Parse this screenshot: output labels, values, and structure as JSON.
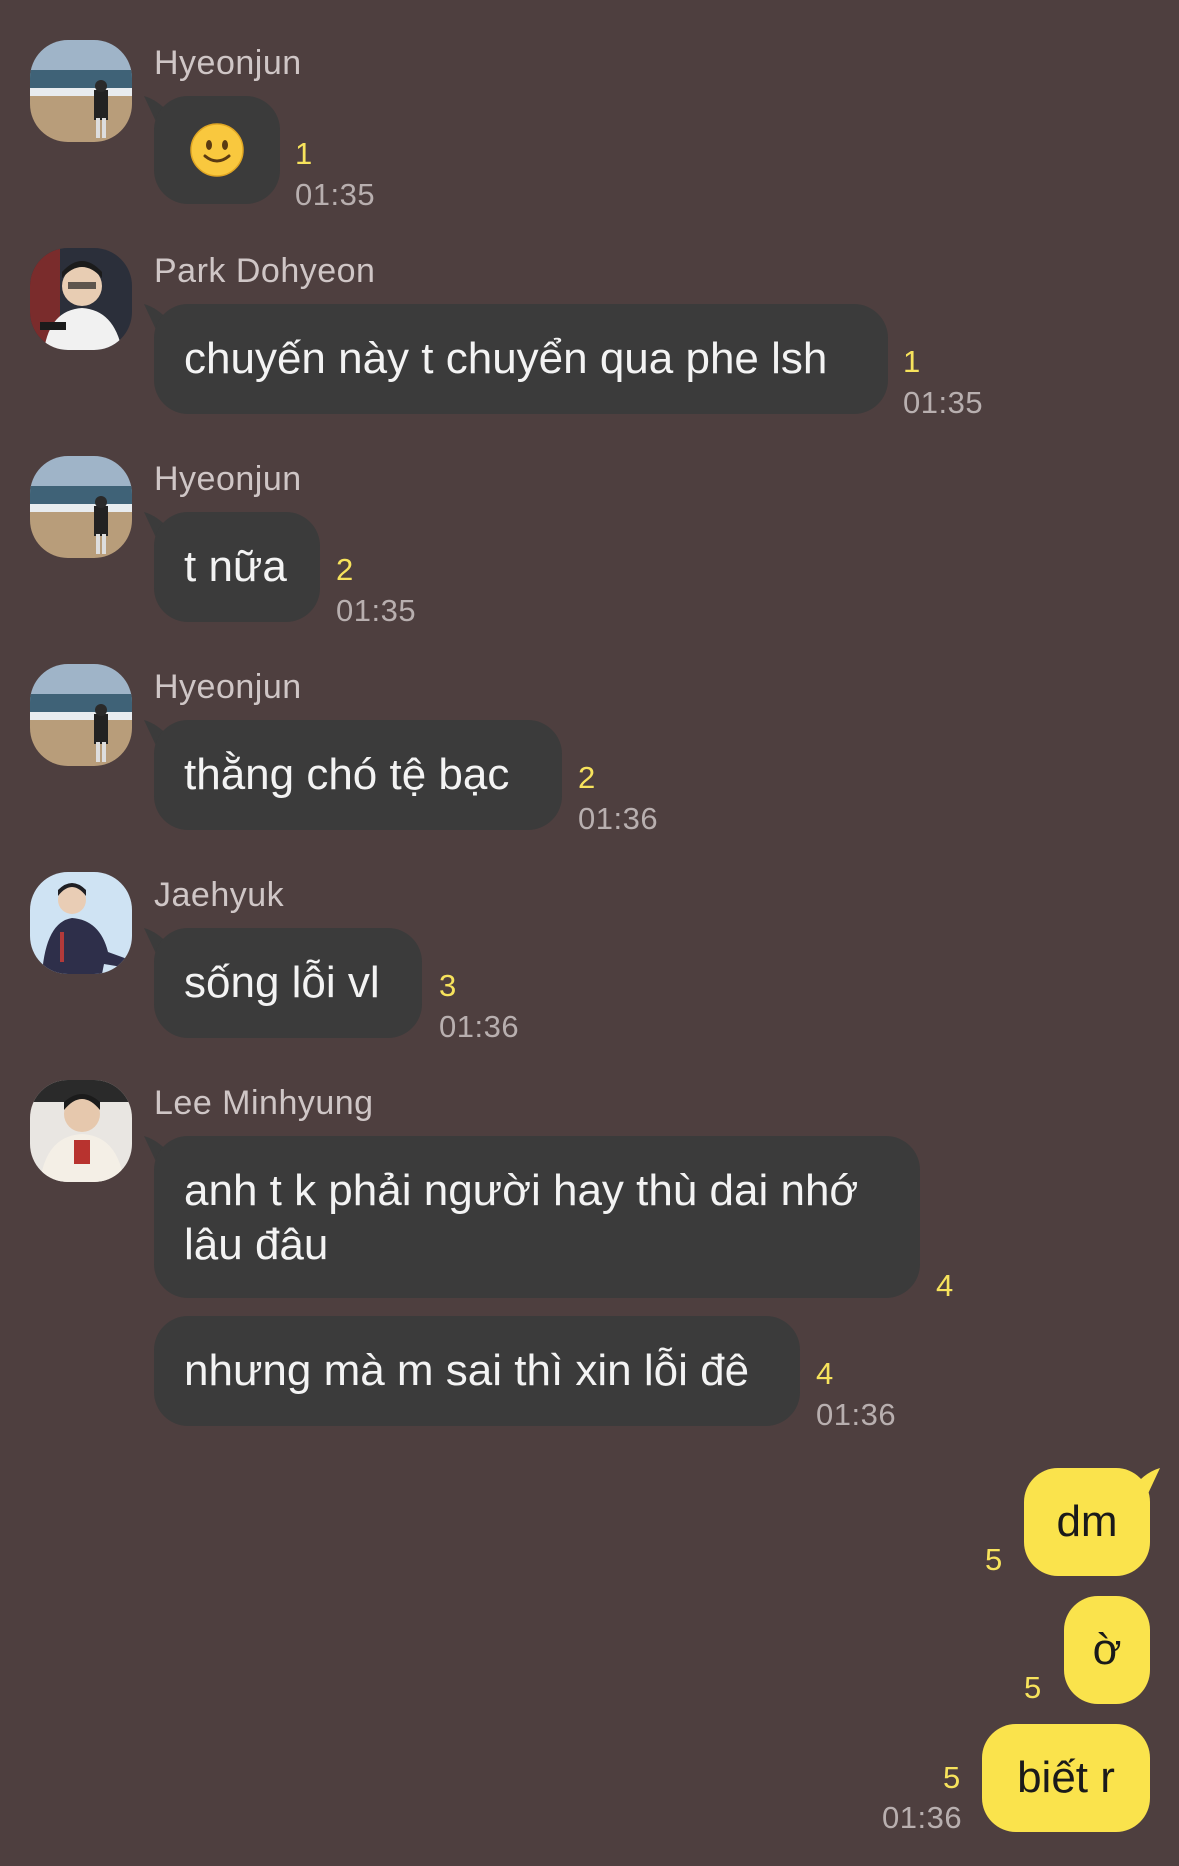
{
  "messages": [
    {
      "sender": "Hyeonjun",
      "text": "",
      "emoji": "slightly-smiling-face",
      "count": "1",
      "time": "01:35"
    },
    {
      "sender": "Park Dohyeon",
      "text": "chuyến này t chuyển qua phe lsh",
      "count": "1",
      "time": "01:35"
    },
    {
      "sender": "Hyeonjun",
      "text": "t nữa",
      "count": "2",
      "time": "01:35"
    },
    {
      "sender": "Hyeonjun",
      "text": "thằng chó tệ bạc",
      "count": "2",
      "time": "01:36"
    },
    {
      "sender": "Jaehyuk",
      "text": "sống lỗi vl",
      "count": "3",
      "time": "01:36"
    },
    {
      "sender": "Lee Minhyung",
      "text": "anh t k phải người hay thù dai nhớ lâu đâu",
      "count": "4",
      "time": ""
    },
    {
      "sender": "",
      "text": "nhưng mà m sai thì xin lỗi đê",
      "count": "4",
      "time": "01:36"
    }
  ],
  "my_messages": [
    {
      "text": "dm",
      "count": "5"
    },
    {
      "text": "ờ",
      "count": "5"
    },
    {
      "text": "biết r",
      "count": "5",
      "time": "01:36"
    }
  ],
  "colors": {
    "background": "#4e3f3f",
    "incoming_bubble": "#3b3b3b",
    "outgoing_bubble": "#fae34c",
    "unread_count": "#f7e35c",
    "timestamp": "#b8afaf"
  }
}
